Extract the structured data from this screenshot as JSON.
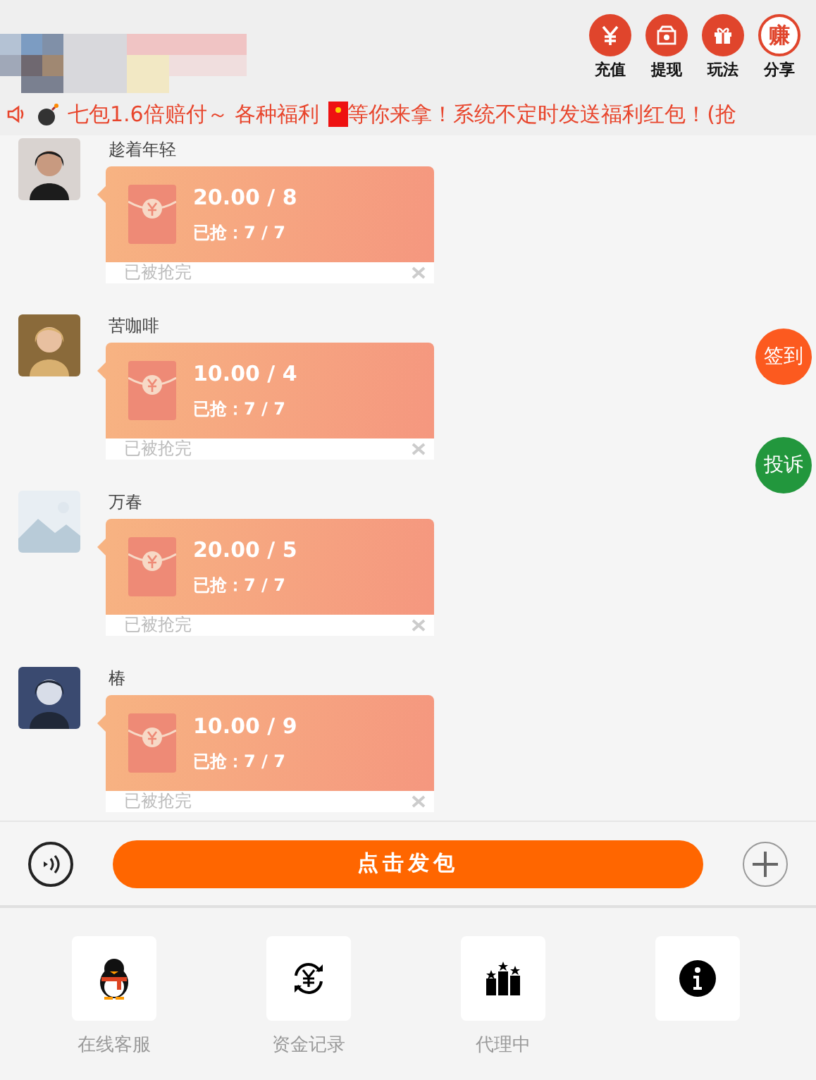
{
  "header": {
    "actions": [
      {
        "kind": "yuan",
        "label": "充值"
      },
      {
        "kind": "box",
        "label": "提现"
      },
      {
        "kind": "gift",
        "label": "玩法"
      },
      {
        "kind": "earn",
        "label": "分享",
        "glyph": "赚"
      }
    ]
  },
  "notice": {
    "parts": [
      "七包1.6倍赔付～ 各种福利",
      "等你来拿！系统不定时发送福利红包！(抢"
    ]
  },
  "messages": [
    {
      "name": "趁着年轻",
      "amount": "20.00 / 8",
      "claimed": "已抢：7 / 7",
      "status": "已被抢完"
    },
    {
      "name": "苦咖啡",
      "amount": "10.00 / 4",
      "claimed": "已抢：7 / 7",
      "status": "已被抢完"
    },
    {
      "name": "万春",
      "amount": "20.00 / 5",
      "claimed": "已抢：7 / 7",
      "status": "已被抢完"
    },
    {
      "name": "椿",
      "amount": "10.00 / 9",
      "claimed": "已抢：7 / 7",
      "status": "已被抢完"
    }
  ],
  "side_buttons": [
    {
      "label": "签到",
      "color": "#fc5a1f"
    },
    {
      "label": "投诉",
      "color": "#22973d"
    }
  ],
  "composer": {
    "send_label": "点击发包"
  },
  "nav": [
    {
      "kind": "penguin",
      "label": "在线客服"
    },
    {
      "kind": "exchange",
      "label": "资金记录"
    },
    {
      "kind": "podium",
      "label": "代理中"
    },
    {
      "kind": "info"
    }
  ]
}
